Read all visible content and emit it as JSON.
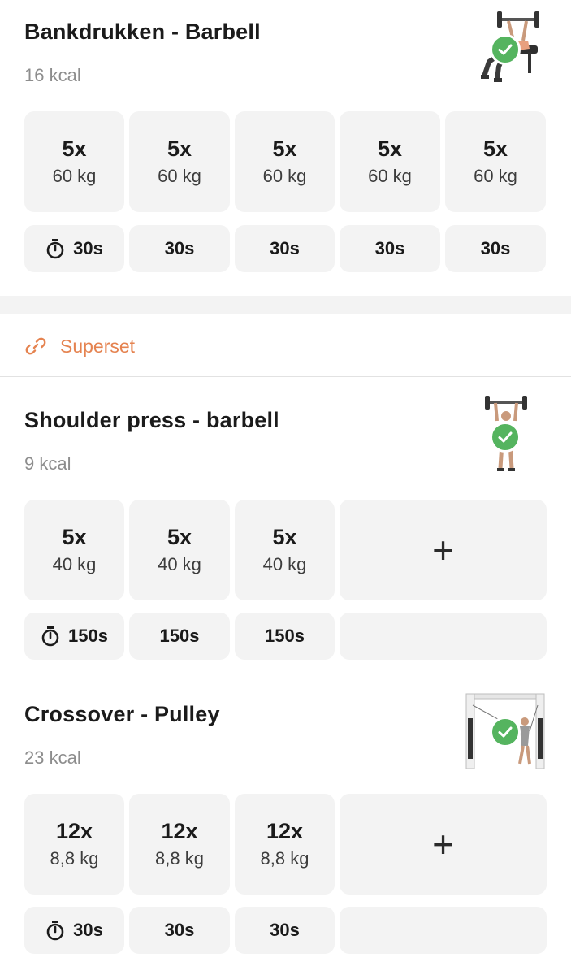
{
  "exercises": [
    {
      "title": "Bankdrukken - Barbell",
      "kcal": "16 kcal",
      "sets": [
        {
          "reps": "5x",
          "weight": "60 kg"
        },
        {
          "reps": "5x",
          "weight": "60 kg"
        },
        {
          "reps": "5x",
          "weight": "60 kg"
        },
        {
          "reps": "5x",
          "weight": "60 kg"
        },
        {
          "reps": "5x",
          "weight": "60 kg"
        }
      ],
      "rests": [
        "30s",
        "30s",
        "30s",
        "30s",
        "30s"
      ],
      "completed": true,
      "image_icon": "bench-press-illustration"
    },
    {
      "title": "Shoulder press - barbell",
      "kcal": "9 kcal",
      "sets": [
        {
          "reps": "5x",
          "weight": "40 kg"
        },
        {
          "reps": "5x",
          "weight": "40 kg"
        },
        {
          "reps": "5x",
          "weight": "40 kg"
        }
      ],
      "rests": [
        "150s",
        "150s",
        "150s"
      ],
      "add_label": "+",
      "completed": true,
      "image_icon": "shoulder-press-illustration"
    },
    {
      "title": "Crossover - Pulley",
      "kcal": "23 kcal",
      "sets": [
        {
          "reps": "12x",
          "weight": "8,8 kg"
        },
        {
          "reps": "12x",
          "weight": "8,8 kg"
        },
        {
          "reps": "12x",
          "weight": "8,8 kg"
        }
      ],
      "rests": [
        "30s",
        "30s",
        "30s"
      ],
      "add_label": "+",
      "completed": true,
      "image_icon": "cable-crossover-illustration"
    }
  ],
  "superset": {
    "label": "Superset",
    "icon": "link-icon"
  },
  "colors": {
    "accent": "#e58350",
    "check": "#55b45f",
    "cell_bg": "#f3f3f3",
    "muted_text": "#8d8d8d"
  }
}
